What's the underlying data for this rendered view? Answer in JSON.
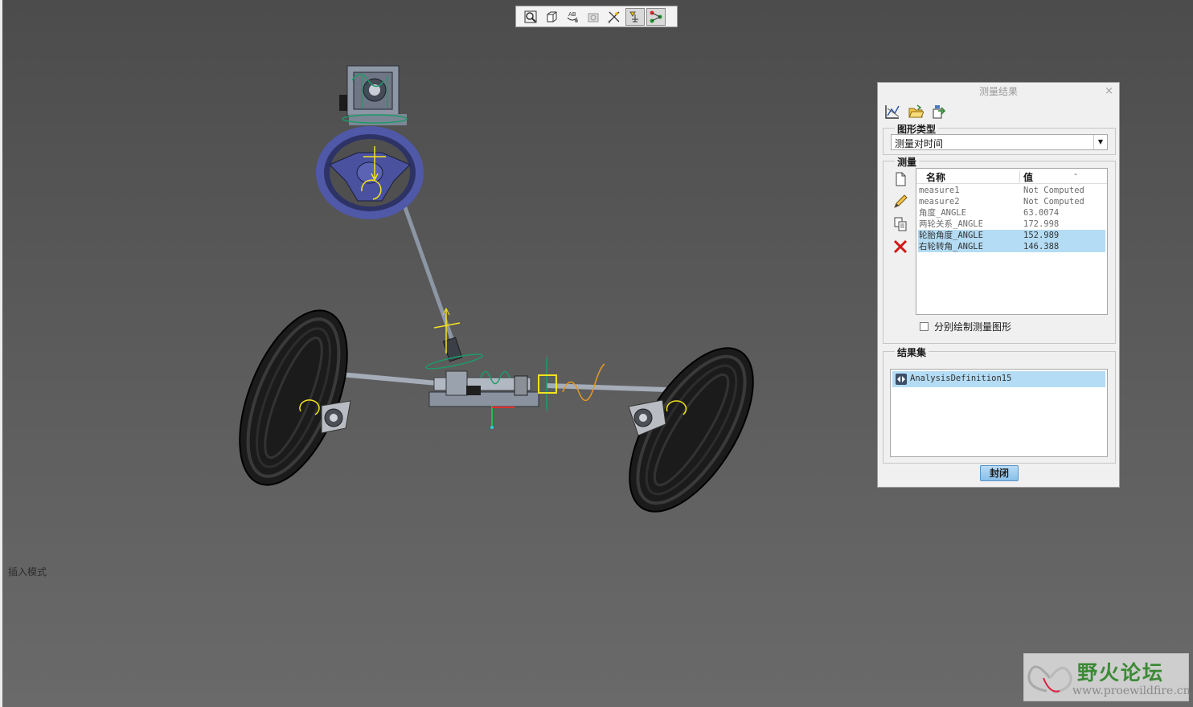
{
  "toolbar": {
    "icons": [
      "zoom-fit-icon",
      "saved-view-icon",
      "annotation-display-icon",
      "spin-center-icon",
      "datum-display-icon",
      "mechanism-display-icon",
      "connection-display-icon"
    ]
  },
  "scene": {
    "mode_text": "插入模式",
    "watermark_title": "野火论坛",
    "watermark_url": "www.proewildfire.cn"
  },
  "dialog": {
    "title": "测量结果",
    "close_glyph": "×",
    "tool_icons": [
      "graph-icon",
      "open-folder-icon",
      "export-icon"
    ],
    "graph_type": {
      "legend": "图形类型",
      "selected": "测量对时间"
    },
    "measure": {
      "legend": "测量",
      "side_icons": [
        "new-measure-icon",
        "edit-pencil-icon",
        "copy-icon",
        "delete-icon"
      ],
      "columns": {
        "name": "名称",
        "value": "值",
        "more": "-"
      },
      "rows": [
        {
          "name": "measure1",
          "value": "Not Computed",
          "selected": false
        },
        {
          "name": "measure2",
          "value": "Not Computed",
          "selected": false
        },
        {
          "name": "角度_ANGLE",
          "value": "63.0074",
          "selected": false
        },
        {
          "name": "两轮关系_ANGLE",
          "value": "172.998",
          "selected": false
        },
        {
          "name": "轮胎角度_ANGLE",
          "value": "152.989",
          "selected": true
        },
        {
          "name": "右轮转角_ANGLE",
          "value": "146.388",
          "selected": true
        }
      ],
      "separate_plot_label": "分别绘制测量图形",
      "separate_plot_checked": false
    },
    "results": {
      "legend": "结果集",
      "items": [
        "AnalysisDefinition15"
      ]
    },
    "close_label": "封闭"
  },
  "colors": {
    "selection": "#b4dcf4",
    "background_top": "#4c4c4c",
    "background_bottom": "#6a6a6a",
    "wheel_blue": "#4a52a0",
    "guide_yellow": "#f4e21c",
    "guide_green": "#1f9a6a",
    "guide_orange": "#e69a22",
    "watermark_green": "#3b8a35"
  }
}
